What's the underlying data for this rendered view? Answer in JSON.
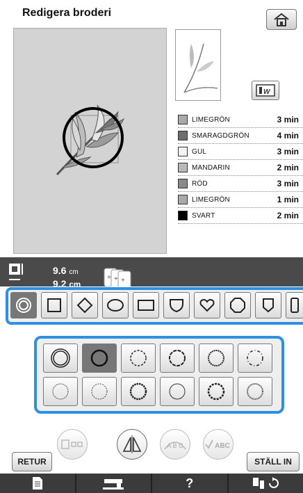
{
  "header": {
    "title": "Redigera broderi"
  },
  "icons": {
    "home": "home-icon",
    "mirror": "mirror-icon",
    "size": "size-icon",
    "copies": "multiple-copies-icon"
  },
  "thread_colors": [
    {
      "name": "LIMEGRÖN",
      "time": "3 min",
      "color": "#a9a9a9"
    },
    {
      "name": "SMARAGDGRÖN",
      "time": "4 min",
      "color": "#6e6e6e"
    },
    {
      "name": "GUL",
      "time": "3 min",
      "color": "#f2f2f2"
    },
    {
      "name": "MANDARIN",
      "time": "2 min",
      "color": "#b9b9b9"
    },
    {
      "name": "RÖD",
      "time": "3 min",
      "color": "#8a8a8a"
    },
    {
      "name": "LIMEGRÖN",
      "time": "1 min",
      "color": "#a9a9a9"
    },
    {
      "name": "SVART",
      "time": "2 min",
      "color": "#000000"
    }
  ],
  "size": {
    "width": "9.6",
    "width_unit": "cm",
    "height": "9.2",
    "height_unit": "cm"
  },
  "frame_shapes": [
    "circle-double",
    "square",
    "diamond",
    "oval",
    "rectangle",
    "shield",
    "heart",
    "hexagon",
    "badge",
    "narrow-rect"
  ],
  "frame_variants": [
    "double-line",
    "thick-line",
    "dashed-small",
    "dashed-wavy",
    "scallop",
    "dotted-dash",
    "zigzag-small",
    "zigzag",
    "bead",
    "thin-line",
    "bead-large",
    "fine-zigzag"
  ],
  "bottom": {
    "retur_label": "RETUR",
    "stall_in_label": "STÄLL IN",
    "abc_arc_label": "A B C",
    "abc_check_label": "ABC"
  },
  "nav": {
    "help_label": "?"
  },
  "colors": {
    "accent": "#2f8fe0",
    "dark_bar": "#4a4a4a",
    "canvas": "#d3d3d3"
  }
}
